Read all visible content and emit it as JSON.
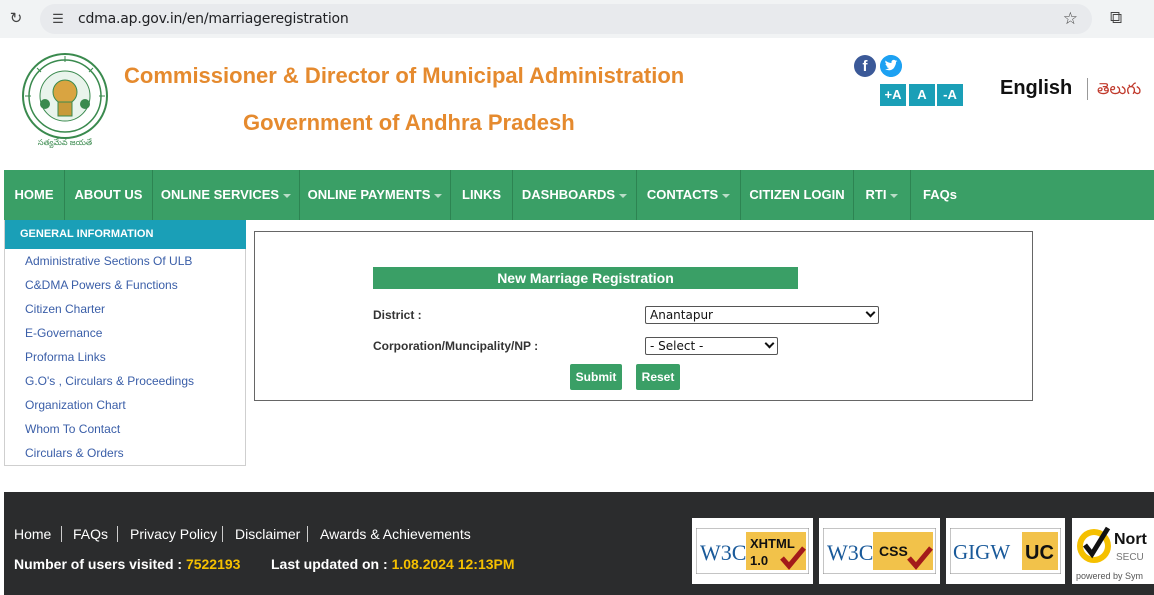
{
  "browser": {
    "url": "cdma.ap.gov.in/en/marriageregistration"
  },
  "header": {
    "title": "Commissioner & Director of Municipal Administration",
    "subtitle": "Government of Andhra Pradesh",
    "emblem_text": "సత్యమేవ జయతే",
    "font_size_buttons": [
      "+A",
      "A",
      "-A"
    ],
    "lang_english": "English",
    "lang_telugu": "తెలుగు"
  },
  "nav": {
    "items": [
      {
        "label": "HOME"
      },
      {
        "label": "ABOUT US"
      },
      {
        "label": "ONLINE SERVICES"
      },
      {
        "label": "ONLINE PAYMENTS"
      },
      {
        "label": "LINKS"
      },
      {
        "label": "DASHBOARDS"
      },
      {
        "label": "CONTACTS"
      },
      {
        "label": "CITIZEN LOGIN"
      },
      {
        "label": "RTI"
      },
      {
        "label": "FAQs"
      }
    ]
  },
  "sidebar": {
    "heading": "GENERAL INFORMATION",
    "links": [
      "Administrative Sections Of ULB",
      "C&DMA Powers & Functions",
      "Citizen Charter",
      "E-Governance",
      "Proforma Links",
      "G.O's , Circulars & Proceedings",
      "Organization Chart",
      "Whom To Contact",
      "Circulars & Orders"
    ]
  },
  "form": {
    "title": "New Marriage Registration",
    "district_label": "District :",
    "district_value": "Anantapur",
    "corporation_label": "Corporation/Muncipality/NP :",
    "corporation_value": "- Select -",
    "submit_label": "Submit",
    "reset_label": "Reset"
  },
  "footer": {
    "links": [
      "Home",
      "FAQs",
      "Privacy Policy",
      "Disclaimer",
      "Awards & Achievements"
    ],
    "visitors_label": "Number of users visited : ",
    "visitors_value": "7522193",
    "updated_label": "Last updated on : ",
    "updated_value": "1.08.2024 12:13PM",
    "badges": {
      "xhtml_w3c": "W3C",
      "xhtml_label": "XHTML",
      "xhtml_version": "1.0",
      "css_w3c": "W3C",
      "css_label": "CSS",
      "gigw": "GIGW",
      "uc": "UC",
      "norton_name": "Nort",
      "norton_secure": "SECU",
      "norton_powered": "powered by Sym"
    }
  }
}
